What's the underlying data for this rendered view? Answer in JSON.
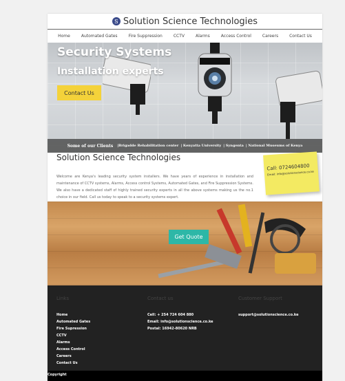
{
  "brand": {
    "title": "Solution Science Technologies",
    "logo_letter": "S"
  },
  "nav": [
    "Home",
    "Automated Gates",
    "Fire Suppression",
    "CCTV",
    "Alarms",
    "Access Control",
    "Careers",
    "Contact Us"
  ],
  "hero": {
    "heading": "Security Systems",
    "subheading": "Installation experts",
    "cta": "Contact Us"
  },
  "clients": {
    "lead": "Some of our Clients",
    "items": [
      "|Brigadde Rehabilitation center",
      "| Kenyatta University",
      "| Syngenta",
      "| National Museums of Kenya"
    ]
  },
  "about": {
    "title": "Solution Science Technologies",
    "text": "Welcome are Kenya's leading security system installers. We have years of experience in installation and maintenance of CCTV systems, Alarms, Access control Systems, Automated Gates, and Fire Suppression Systems. We also have a dedicated staff of highly trained security experts in all the above systems making us the no.1 choice in our field. Call us today to speak to a security systems expert."
  },
  "sticky": {
    "call": "Call: 0724604800",
    "email": "Email: info@solutionscience.co.ke"
  },
  "tools": {
    "cta": "Get Quote"
  },
  "footer": {
    "col1": {
      "heading": "Links",
      "items": [
        "Home",
        "Automated Gates",
        "Fire Supression",
        "CCTV",
        "Alarms",
        "Access Control",
        "Careers",
        "Contact Us"
      ]
    },
    "col2": {
      "heading": "Contact us",
      "items": [
        "Cell: + 254 724 604 880",
        "Email: info@solutionscience.co.ke",
        "Postal: 16942-80620 NRB"
      ]
    },
    "col3": {
      "heading": "Customer Support",
      "items": [
        "support@solutionscience.co.ke"
      ]
    },
    "copyright": "Copyright"
  },
  "colors": {
    "accent_yellow": "#f4d23a",
    "accent_teal": "#2db7a7",
    "footer_bg": "#222222"
  }
}
